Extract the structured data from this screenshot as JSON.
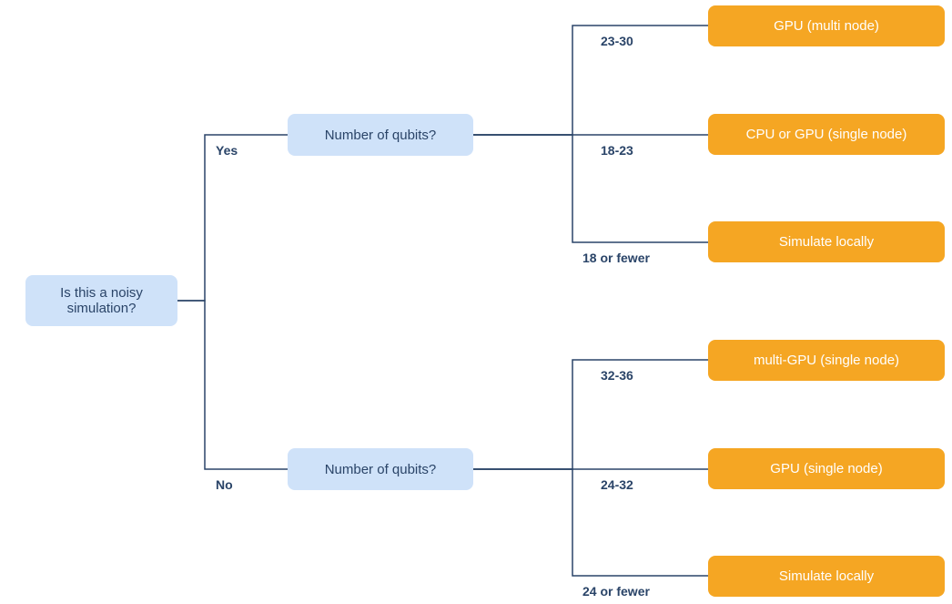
{
  "root": {
    "label": "Is this a noisy simulation?"
  },
  "branches": {
    "yes": {
      "label": "Yes",
      "question": "Number of qubits?",
      "options": {
        "opt1": {
          "range": "23-30",
          "result": "GPU (multi node)"
        },
        "opt2": {
          "range": "18-23",
          "result": "CPU or GPU (single node)"
        },
        "opt3": {
          "range": "18 or fewer",
          "result": "Simulate locally"
        }
      }
    },
    "no": {
      "label": "No",
      "question": "Number of qubits?",
      "options": {
        "opt1": {
          "range": "32-36",
          "result": "multi-GPU (single node)"
        },
        "opt2": {
          "range": "24-32",
          "result": "GPU (single node)"
        },
        "opt3": {
          "range": "24 or fewer",
          "result": "Simulate locally"
        }
      }
    }
  }
}
